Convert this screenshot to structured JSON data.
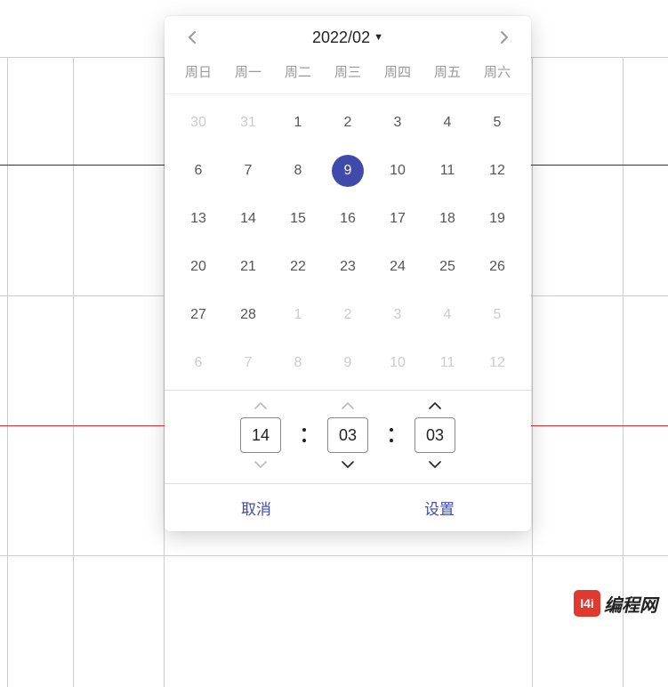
{
  "datepicker": {
    "title": "2022/02",
    "weekdays": [
      "周日",
      "周一",
      "周二",
      "周三",
      "周四",
      "周五",
      "周六"
    ],
    "cells": [
      {
        "d": 30,
        "out": true
      },
      {
        "d": 31,
        "out": true
      },
      {
        "d": 1
      },
      {
        "d": 2
      },
      {
        "d": 3
      },
      {
        "d": 4
      },
      {
        "d": 5
      },
      {
        "d": 6
      },
      {
        "d": 7
      },
      {
        "d": 8
      },
      {
        "d": 9,
        "selected": true
      },
      {
        "d": 10
      },
      {
        "d": 11
      },
      {
        "d": 12
      },
      {
        "d": 13
      },
      {
        "d": 14
      },
      {
        "d": 15
      },
      {
        "d": 16
      },
      {
        "d": 17
      },
      {
        "d": 18
      },
      {
        "d": 19
      },
      {
        "d": 20
      },
      {
        "d": 21
      },
      {
        "d": 22
      },
      {
        "d": 23
      },
      {
        "d": 24
      },
      {
        "d": 25
      },
      {
        "d": 26
      },
      {
        "d": 27
      },
      {
        "d": 28
      },
      {
        "d": 1,
        "out": true
      },
      {
        "d": 2,
        "out": true
      },
      {
        "d": 3,
        "out": true
      },
      {
        "d": 4,
        "out": true
      },
      {
        "d": 5,
        "out": true
      },
      {
        "d": 6,
        "out": true
      },
      {
        "d": 7,
        "out": true
      },
      {
        "d": 8,
        "out": true
      },
      {
        "d": 9,
        "out": true
      },
      {
        "d": 10,
        "out": true
      },
      {
        "d": 11,
        "out": true
      },
      {
        "d": 12,
        "out": true
      }
    ],
    "time": {
      "hour": "14",
      "minute": "03",
      "second": "03"
    },
    "footer": {
      "cancel": "取消",
      "set": "设置"
    }
  },
  "watermark": {
    "badge": "I4i",
    "text": "编程网"
  }
}
